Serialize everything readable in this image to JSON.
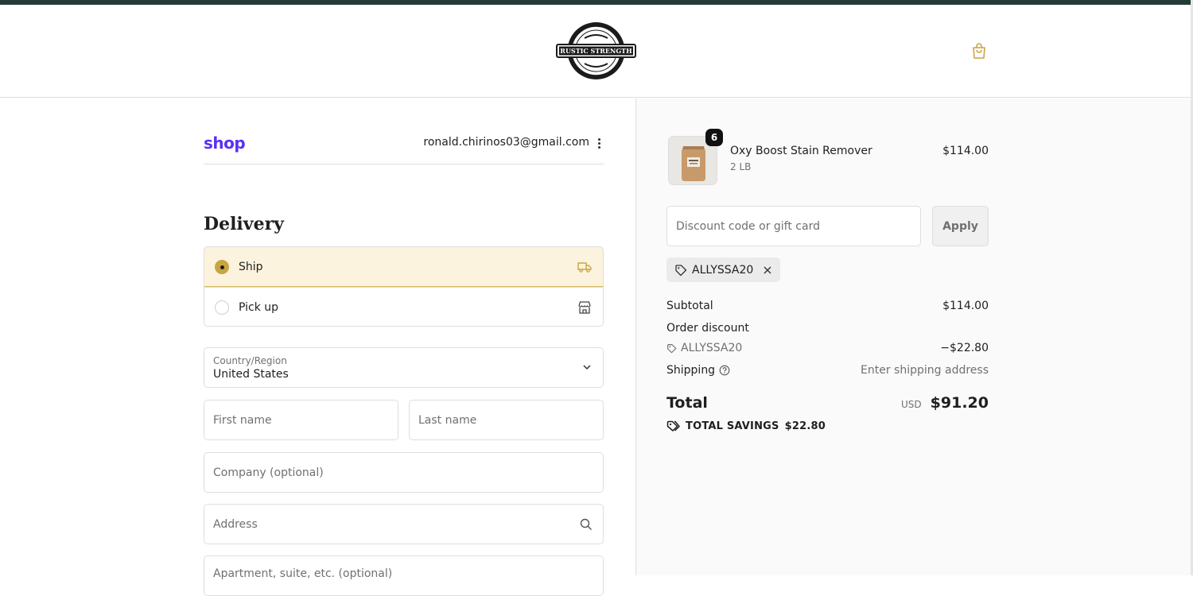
{
  "header": {
    "logo_text": "RUSTIC STRENGTH",
    "cart_icon": "shopping-bag-icon"
  },
  "account": {
    "shop_logo": "shop",
    "email": "ronald.chirinos03@gmail.com"
  },
  "delivery": {
    "title": "Delivery",
    "options": [
      {
        "label": "Ship",
        "icon": "truck-icon",
        "selected": true
      },
      {
        "label": "Pick up",
        "icon": "store-icon",
        "selected": false
      }
    ]
  },
  "form": {
    "country_label": "Country/Region",
    "country_value": "United States",
    "first_name_placeholder": "First name",
    "last_name_placeholder": "Last name",
    "company_placeholder": "Company (optional)",
    "address_placeholder": "Address",
    "apartment_placeholder": "Apartment, suite, etc. (optional)"
  },
  "summary": {
    "product": {
      "name": "Oxy Boost Stain Remover",
      "variant": "2 LB",
      "price": "$114.00",
      "quantity": "6"
    },
    "discount_placeholder": "Discount code or gift card",
    "apply_label": "Apply",
    "applied_code": "ALLYSSA20",
    "subtotal_label": "Subtotal",
    "subtotal_value": "$114.00",
    "order_discount_label": "Order discount",
    "discount_code": "ALLYSSA20",
    "discount_value": "−$22.80",
    "shipping_label": "Shipping",
    "shipping_value": "Enter shipping address",
    "total_label": "Total",
    "currency": "USD",
    "total_value": "$91.20",
    "savings_label": "TOTAL SAVINGS",
    "savings_value": "$22.80"
  },
  "colors": {
    "accent": "#c9a443",
    "selected_bg": "#fbf3dd",
    "shop_brand": "#5a31f4",
    "topbar": "#243b39"
  }
}
